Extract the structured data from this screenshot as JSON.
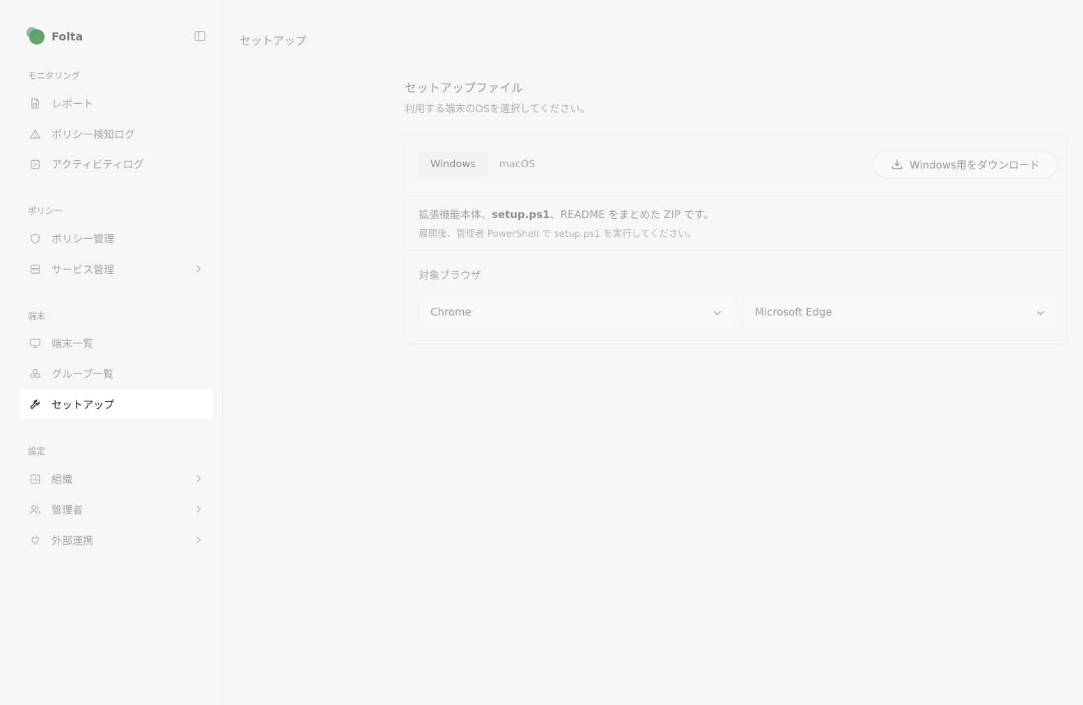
{
  "brand": {
    "name": "Folta"
  },
  "header": {
    "title": "セットアップ"
  },
  "sidebar": {
    "groups": [
      {
        "label": "モニタリング",
        "items": [
          {
            "label": "レポート",
            "icon": "file-icon"
          },
          {
            "label": "ポリシー検知ログ",
            "icon": "warning-icon"
          },
          {
            "label": "アクティビティログ",
            "icon": "calendar-icon"
          }
        ]
      },
      {
        "label": "ポリシー",
        "items": [
          {
            "label": "ポリシー管理",
            "icon": "shield-icon"
          },
          {
            "label": "サービス管理",
            "icon": "server-icon",
            "has_submenu": true
          }
        ]
      },
      {
        "label": "端末",
        "items": [
          {
            "label": "端末一覧",
            "icon": "monitor-icon"
          },
          {
            "label": "グループ一覧",
            "icon": "group-icon"
          },
          {
            "label": "セットアップ",
            "icon": "wrench-icon",
            "active": true
          }
        ]
      },
      {
        "label": "設定",
        "items": [
          {
            "label": "組織",
            "icon": "building-icon",
            "has_submenu": true
          },
          {
            "label": "管理者",
            "icon": "users-icon",
            "has_submenu": true
          },
          {
            "label": "外部連携",
            "icon": "plug-icon",
            "has_submenu": true
          }
        ]
      }
    ]
  },
  "main": {
    "section_title": "セットアップファイル",
    "section_subtitle": "利用する端末のOSを選択してください。",
    "tabs": [
      {
        "label": "Windows",
        "active": true
      },
      {
        "label": "macOS",
        "active": false
      }
    ],
    "download_label": "Windows用をダウンロード",
    "description": {
      "part1": "拡張機能本体、",
      "file": "setup.ps1",
      "part2": "、README をまとめた ZIP です。"
    },
    "description_sub": "展開後、管理者 PowerShell で setup.ps1 を実行してください。",
    "browser_label": "対象ブラウザ",
    "browsers": [
      {
        "selected": "Chrome"
      },
      {
        "selected": "Microsoft Edge"
      }
    ]
  }
}
